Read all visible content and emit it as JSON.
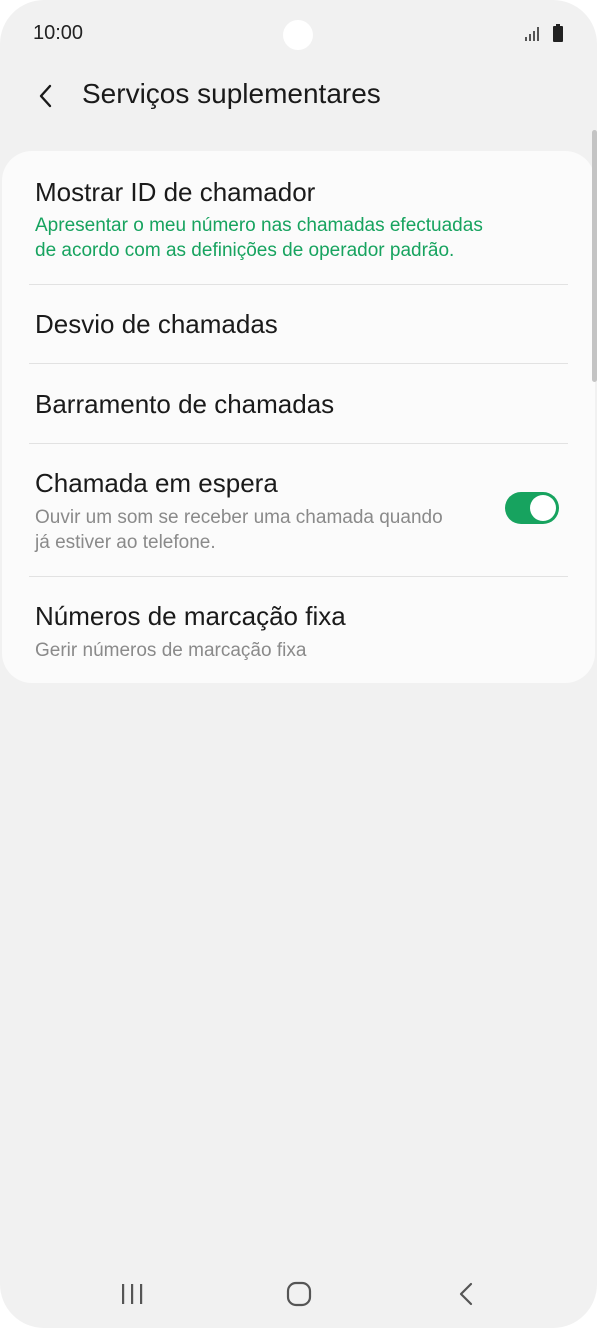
{
  "status_bar": {
    "time": "10:00",
    "icons": [
      "signal-icon",
      "battery-icon"
    ]
  },
  "header": {
    "back_icon": "chevron-left-icon",
    "title": "Serviços suplementares"
  },
  "settings": {
    "items": [
      {
        "title": "Mostrar ID de chamador",
        "subtitle_line1": "Apresentar o meu número nas chamadas efectuadas",
        "subtitle_line2": "de acordo com as definições de operador padrão."
      },
      {
        "title": "Desvio de chamadas"
      },
      {
        "title": "Barramento de chamadas"
      },
      {
        "title": "Chamada em espera",
        "subtitle_line1": "Ouvir um som se receber uma chamada quando",
        "subtitle_line2": "já estiver ao telefone.",
        "toggle_on": true
      },
      {
        "title": "Números de marcação fixa",
        "subtitle_line1": "Gerir números de marcação fixa"
      }
    ]
  },
  "nav_bar": {
    "icons": [
      "recent-apps-icon",
      "home-icon",
      "back-icon"
    ]
  },
  "colors": {
    "accent": "#17a35f",
    "background": "#f1f1f1",
    "card": "#fbfbfb"
  }
}
